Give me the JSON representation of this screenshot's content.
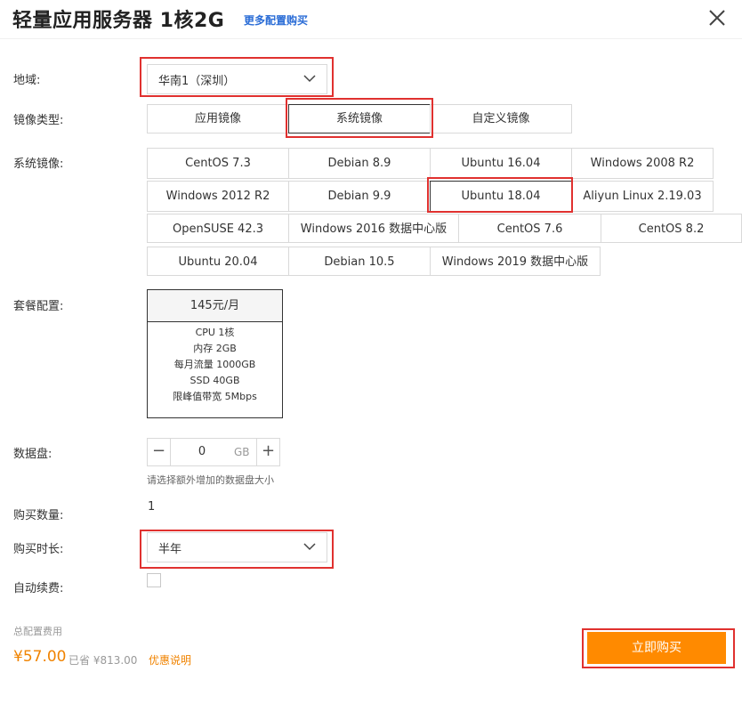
{
  "header": {
    "title": "轻量应用服务器 1核2G",
    "more_link": "更多配置购买"
  },
  "labels": {
    "region": "地域:",
    "image_type": "镜像类型:",
    "system_image": "系统镜像:",
    "package": "套餐配置:",
    "data_disk": "数据盘:",
    "quantity": "购买数量:",
    "duration": "购买时长:",
    "auto_renew": "自动续费:"
  },
  "region": {
    "value": "华南1（深圳）"
  },
  "image_types": {
    "app": "应用镜像",
    "system": "系统镜像",
    "custom": "自定义镜像",
    "selected": "系统镜像"
  },
  "system_images": {
    "centos73": "CentOS 7.3",
    "debian89": "Debian 8.9",
    "ubuntu1604": "Ubuntu 16.04",
    "win2008": "Windows 2008 R2",
    "win2012": "Windows 2012 R2",
    "debian99": "Debian 9.9",
    "ubuntu1804": "Ubuntu 18.04",
    "aliyun": "Aliyun Linux 2.19.03",
    "opensuse": "OpenSUSE 42.3",
    "win2016": "Windows 2016 数据中心版",
    "centos76": "CentOS 7.6",
    "centos82": "CentOS 8.2",
    "ubuntu2004": "Ubuntu 20.04",
    "debian105": "Debian 10.5",
    "win2019": "Windows 2019 数据中心版",
    "selected": "Ubuntu 18.04"
  },
  "package": {
    "price": "145元/月",
    "cpu": "CPU 1核",
    "memory": "内存 2GB",
    "traffic": "每月流量 1000GB",
    "ssd": "SSD 40GB",
    "bandwidth": "限峰值带宽 5Mbps"
  },
  "data_disk": {
    "minus": "−",
    "value": "0",
    "unit": "GB",
    "plus": "+",
    "hint": "请选择额外增加的数据盘大小"
  },
  "quantity": {
    "value": "1"
  },
  "duration": {
    "value": "半年"
  },
  "auto_renew": {
    "checked": false
  },
  "footer": {
    "total_label": "总配置费用",
    "price": "¥57.00",
    "saved": "已省 ¥813.00",
    "promo": "优惠说明",
    "buy_button": "立即购买"
  },
  "colors": {
    "accent": "#ff8a00",
    "price": "#f08300",
    "link": "#2a6cd6",
    "highlight_box": "#e0312f"
  },
  "icons": {
    "close": "close-icon",
    "dropdown": "chevron-down-icon"
  }
}
